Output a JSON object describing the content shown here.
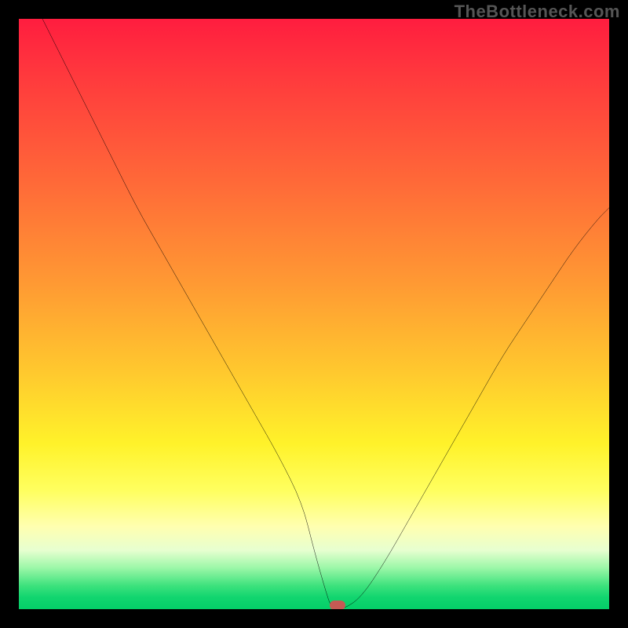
{
  "attribution": "TheBottleneck.com",
  "chart_data": {
    "type": "line",
    "title": "",
    "xlabel": "",
    "ylabel": "",
    "xlim": [
      0,
      100
    ],
    "ylim": [
      0,
      100
    ],
    "grid": false,
    "legend": false,
    "curve": {
      "name": "bottleneck-curve",
      "color": "#000000",
      "x": [
        4,
        8,
        12,
        16,
        20,
        24,
        28,
        32,
        36,
        40,
        44,
        48,
        50,
        52,
        53,
        55,
        58,
        62,
        66,
        70,
        74,
        78,
        82,
        86,
        90,
        94,
        98,
        100
      ],
      "y": [
        100,
        92,
        84,
        76,
        68,
        61,
        54,
        47,
        40,
        33,
        26,
        18,
        10,
        3,
        0,
        0,
        2,
        8,
        15,
        22,
        29,
        36,
        43,
        49,
        55,
        61,
        66,
        68
      ]
    },
    "marker": {
      "x": 54,
      "y": 0,
      "color": "#c55a54"
    },
    "background_gradient": {
      "direction": "vertical",
      "stops": [
        {
          "pos": 0.0,
          "color": "#ff1d3f"
        },
        {
          "pos": 0.28,
          "color": "#ff6a38"
        },
        {
          "pos": 0.6,
          "color": "#ffc92e"
        },
        {
          "pos": 0.8,
          "color": "#ffff60"
        },
        {
          "pos": 0.93,
          "color": "#9cf7a8"
        },
        {
          "pos": 1.0,
          "color": "#04cf68"
        }
      ]
    }
  }
}
